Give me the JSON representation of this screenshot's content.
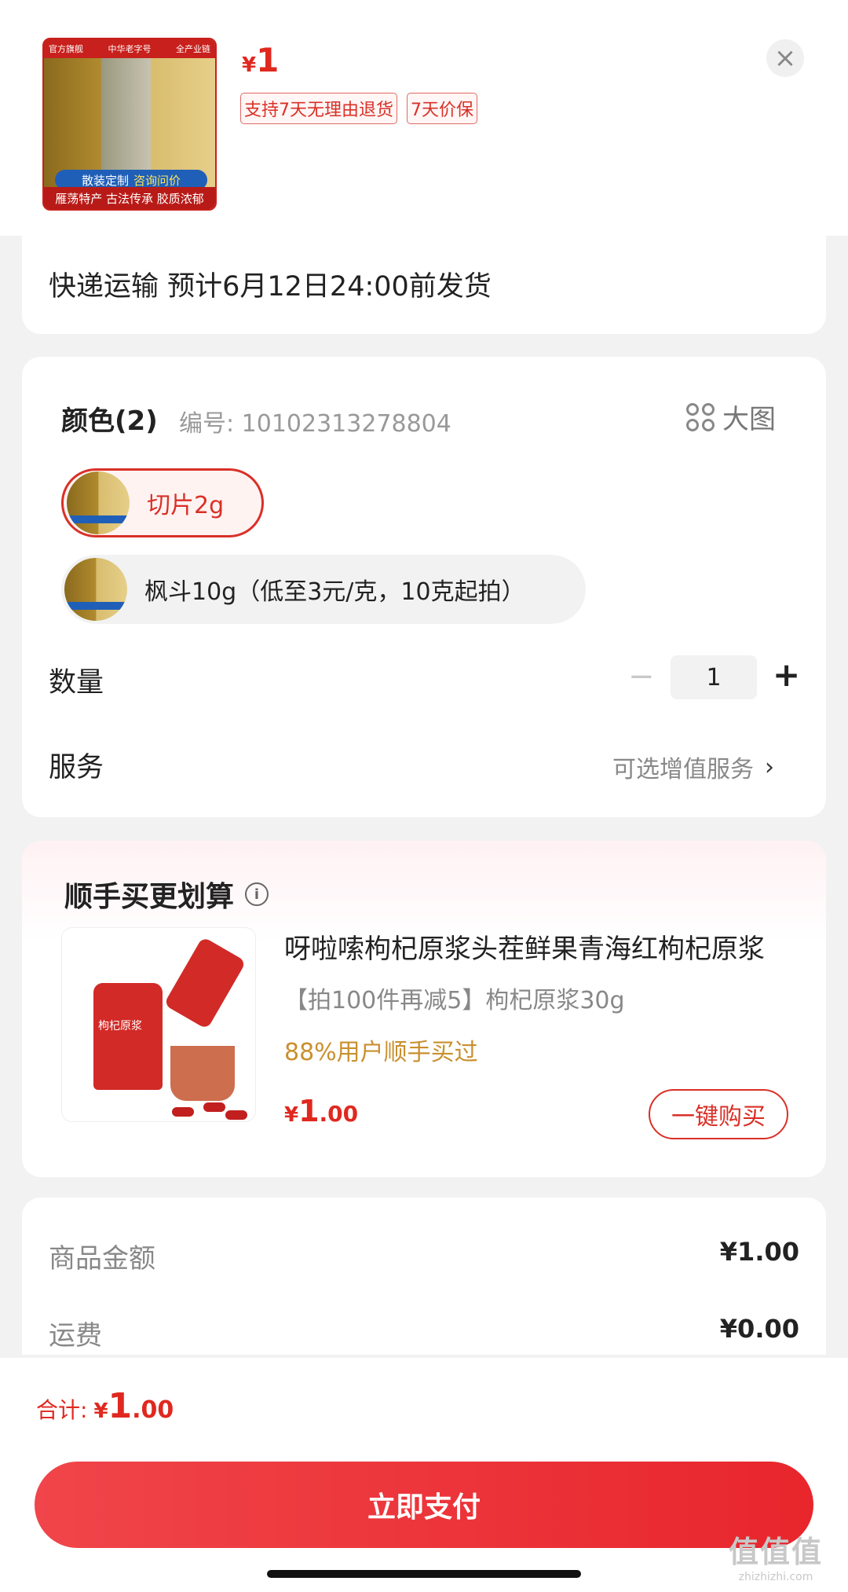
{
  "product": {
    "image_top_left": "官方旗舰",
    "image_top_mid": "中华老字号",
    "image_top_right": "全产业链",
    "image_pill_left": "散装定制",
    "image_pill_right": "咨询问价",
    "image_bottom": "雁荡特产 古法传承 胶质浓郁",
    "price_currency": "¥",
    "price_value": "1",
    "tags": [
      "支持7天无理由退货",
      "7天价保"
    ]
  },
  "shipping": {
    "text": "快递运输 预计6月12日24:00前发货"
  },
  "spec": {
    "title": "颜色(2)",
    "code": "编号: 10102313278804",
    "big_image_label": "大图",
    "options": [
      {
        "label": "切片2g",
        "selected": true
      },
      {
        "label": "枫斗10g（低至3元/克，10克起拍）",
        "selected": false
      }
    ],
    "quantity_label": "数量",
    "quantity_minus": "−",
    "quantity_value": "1",
    "quantity_plus": "+",
    "service_label": "服务",
    "service_value": "可选增值服务",
    "service_chevron": "›"
  },
  "bundle": {
    "title": "顺手买更划算",
    "info_icon": "i",
    "image_label": "枸杞原浆",
    "name": "呀啦嗦枸杞原浆头茬鲜果青海红枸杞原浆",
    "sku": "【拍100件再减5】枸杞原浆30g",
    "percent": "88%用户顺手买过",
    "price_currency": "¥",
    "price_int": "1",
    "price_dec": ".00",
    "buy_label": "一键购买"
  },
  "summary": {
    "rows": [
      {
        "label": "商品金额",
        "value": "¥1.00"
      },
      {
        "label": "运费",
        "value": "¥0.00"
      }
    ]
  },
  "footer": {
    "total_label": "合计:",
    "total_currency": "¥",
    "total_int": "1",
    "total_dec": ".00",
    "pay_label": "立即支付"
  },
  "watermark": {
    "big": "值值值",
    "small": "zhizhizhi.com"
  },
  "colors": {
    "accent": "#e0281f",
    "gold": "#c9902e",
    "pay_start": "#f0454a",
    "pay_end": "#e8262c"
  },
  "icons": {
    "close": "close-icon",
    "grid": "grid-icon",
    "info": "info-icon",
    "chevron": "chevron-right-icon"
  }
}
